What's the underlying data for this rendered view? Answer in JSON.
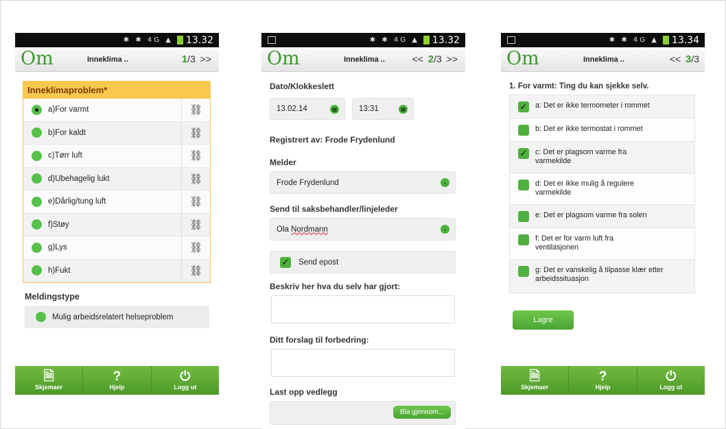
{
  "status": {
    "time_1": "13.32",
    "time_2": "13.32",
    "time_3": "13.34",
    "network": "4G"
  },
  "app": {
    "logo": "Om",
    "title": "Inneklima .."
  },
  "phone1": {
    "pager_page": "1",
    "pager_total": "/3",
    "pager_next": ">>",
    "question": "Inneklimaproblem*",
    "options": [
      "a)For varmt",
      "b)For kaldt",
      "c)Tørr luft",
      "d)Ubehagelig lukt",
      "e)Dårlig/tung luft",
      "f)Støy",
      "g)Lys",
      "h)Fukt"
    ],
    "message_type_label": "Meldingstype",
    "message_type_value": "Mulig arbeidsrelatert helseproblem"
  },
  "bottom_nav": {
    "forms": "Skjemaer",
    "help": "Hjelp",
    "logout": "Logg ut"
  },
  "phone2": {
    "pager_prev": "<<",
    "pager_page": "2",
    "pager_total": "/3",
    "pager_next": ">>",
    "datetime_label": "Dato/Klokkeslett",
    "date_value": "13.02.14",
    "time_value": "13:31",
    "registered_by": "Registrert av: Frode Frydenlund",
    "reporter_label": "Melder",
    "reporter_value": "Frode Frydenlund",
    "send_to_label": "Send til saksbehandler/linjeleder",
    "send_to_value_first": "Ola",
    "send_to_value_last": "Nordmann",
    "send_email_label": "Send epost",
    "describe_label": "Beskriv her hva du selv har gjort:",
    "suggestion_label": "Ditt forslag til forbedring:",
    "upload_label": "Last opp vedlegg",
    "browse_button": "Bla gjennom..."
  },
  "phone3": {
    "pager_prev": "<<",
    "pager_page": "3",
    "pager_total": "/3",
    "question": "1. For varmt: Ting du kan sjekke selv.",
    "items": [
      {
        "text": "a: Det er ikke termometer i rommet",
        "checked": true
      },
      {
        "text": "b: Det er ikke termostat i rommet",
        "checked": false
      },
      {
        "text": "c: Det er plagsom varme fra varmekilde",
        "checked": true
      },
      {
        "text": "d: Det er ikke mulig å regulere varmekilde",
        "checked": false
      },
      {
        "text": "e: Det er plagsom varme fra solen",
        "checked": false
      },
      {
        "text": "f: Det er for varm luft fra ventilasjonen",
        "checked": false
      },
      {
        "text": "g: Det er vanskelig å tilpasse klær etter arbeidssituasjon",
        "checked": false
      }
    ],
    "save_button": "Lagre"
  }
}
